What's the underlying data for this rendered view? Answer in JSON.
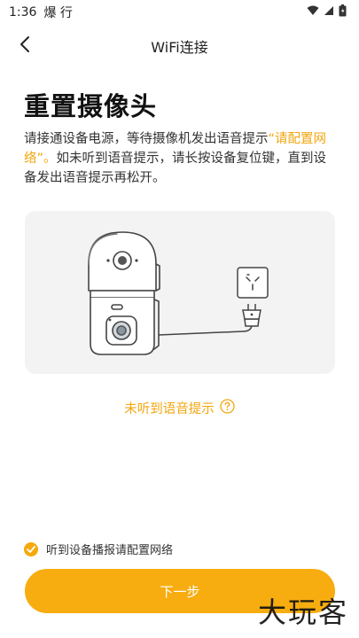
{
  "status_bar": {
    "time": "1:36",
    "app_indicators": "爆 行"
  },
  "nav": {
    "title": "WiFi连接"
  },
  "page": {
    "title": "重置摄像头",
    "desc_part1": "请接通设备电源，等待摄像机发出语音提示",
    "desc_highlight": "“请配置网络”。",
    "desc_part2": "如未听到语音提示，请长按设备复位键，直到设备发出语音提示再松开。"
  },
  "hint": {
    "label": "未听到语音提示"
  },
  "confirm": {
    "label": "听到设备播报请配置网络",
    "checked": true
  },
  "next_button": {
    "label": "下一步"
  },
  "watermark": {
    "text": "大玩客"
  },
  "colors": {
    "accent": "#f7ac10",
    "highlight_text": "#f2a60e",
    "illustration_bg": "#f3f3f3"
  }
}
